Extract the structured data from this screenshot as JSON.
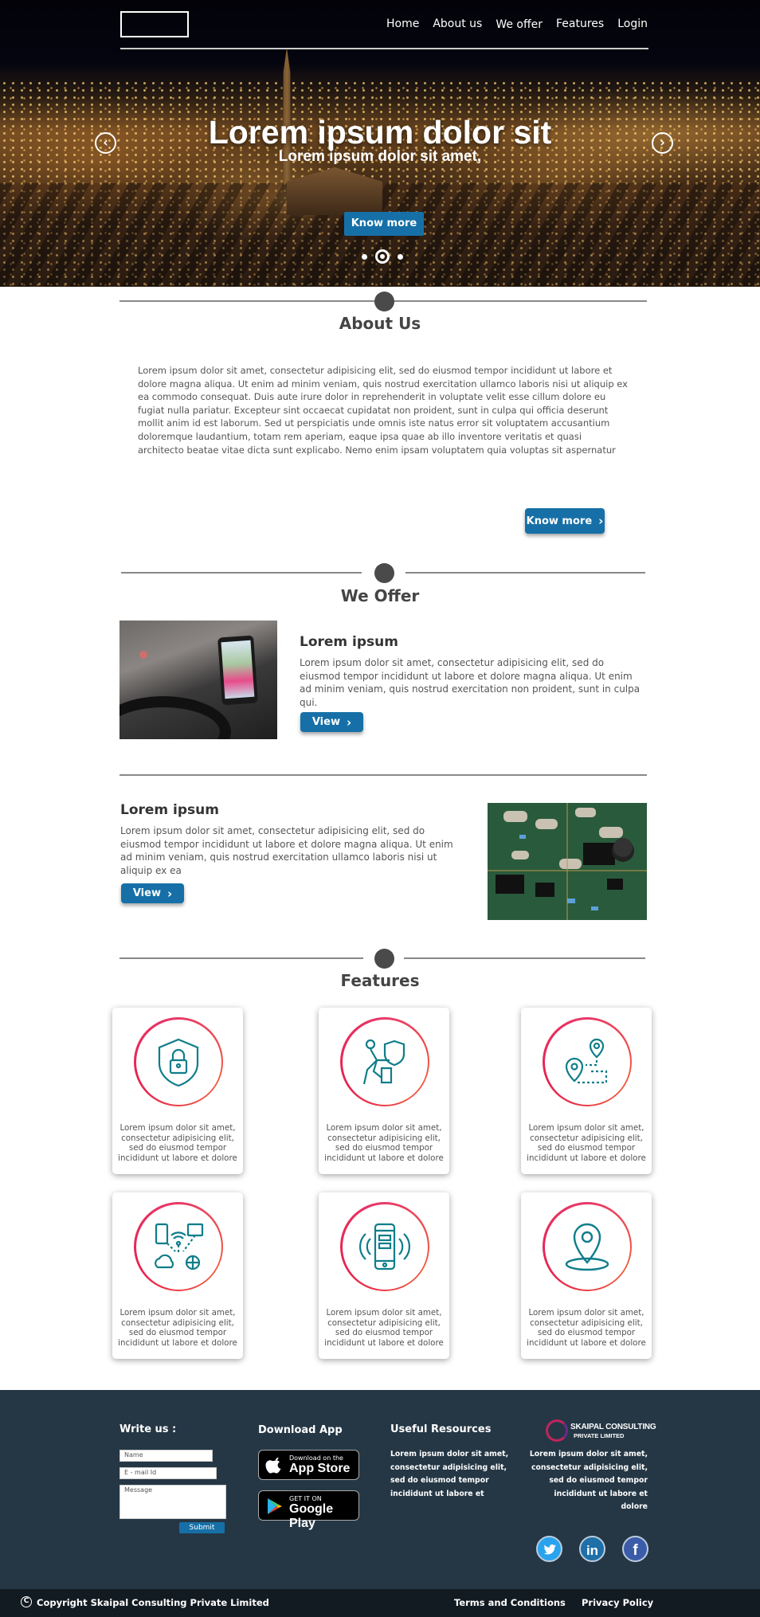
{
  "nav": {
    "items": [
      "Home",
      "About us",
      "We offer",
      "Features",
      "Login"
    ]
  },
  "hero": {
    "title": "Lorem ipsum dolor sit",
    "subtitle": "Lorem ipsum dolor sit amet,",
    "button": "Know more",
    "prev_icon": "chevron-left-icon",
    "next_icon": "chevron-right-icon",
    "active_slide": 2,
    "slide_count": 3
  },
  "about": {
    "title": "About Us",
    "text": "Lorem ipsum dolor sit amet, consectetur adipisicing elit, sed do eiusmod tempor incididunt ut labore et dolore magna aliqua. Ut enim ad minim veniam, quis nostrud exercitation ullamco laboris nisi ut aliquip ex ea commodo consequat. Duis aute irure dolor in reprehenderit in voluptate velit esse cillum dolore eu fugiat nulla pariatur. Excepteur sint occaecat cupidatat non proident, sunt in culpa qui officia deserunt mollit anim id est laborum. Sed ut perspiciatis unde omnis iste natus error sit voluptatem accusantium doloremque laudantium, totam rem aperiam, eaque ipsa quae ab illo inventore veritatis et quasi architecto beatae vitae dicta sunt explicabo. Nemo enim ipsam voluptatem quia voluptas sit aspernatur",
    "button": "Know more"
  },
  "offer": {
    "title": "We Offer",
    "items": [
      {
        "title": "Lorem ipsum",
        "text": "Lorem ipsum dolor sit amet, consectetur adipisicing elit, sed do eiusmod tempor incididunt ut labore et dolore magna aliqua. Ut enim ad minim veniam, quis nostrud exercitation non proident, sunt in culpa qui.",
        "button": "View"
      },
      {
        "title": "Lorem ipsum",
        "text": "Lorem ipsum dolor sit amet, consectetur adipisicing elit, sed do eiusmod tempor incididunt ut labore et dolore magna aliqua. Ut enim ad minim veniam, quis nostrud exercitation ullamco laboris nisi ut aliquip ex ea",
        "button": "View"
      }
    ]
  },
  "features": {
    "title": "Features",
    "cards": [
      {
        "icon": "shield-lock-icon",
        "text": "Lorem ipsum dolor sit amet, consectetur adipisicing elit, sed do eiusmod tempor incididunt ut labore et dolore"
      },
      {
        "icon": "person-shield-icon",
        "text": "Lorem ipsum dolor sit amet, consectetur adipisicing elit, sed do eiusmod tempor incididunt ut labore et dolore"
      },
      {
        "icon": "route-pins-icon",
        "text": "Lorem ipsum dolor sit amet, consectetur adipisicing elit, sed do eiusmod tempor incididunt ut labore et dolore"
      },
      {
        "icon": "network-devices-icon",
        "text": "Lorem ipsum dolor sit amet, consectetur adipisicing elit, sed do eiusmod tempor incididunt ut labore et dolore"
      },
      {
        "icon": "phone-signal-icon",
        "text": "Lorem ipsum dolor sit amet, consectetur adipisicing elit, sed do eiusmod tempor incididunt ut labore et dolore"
      },
      {
        "icon": "map-pin-icon",
        "text": "Lorem ipsum dolor sit amet, consectetur adipisicing elit, sed do eiusmod tempor incididunt ut labore et dolore"
      }
    ]
  },
  "footer": {
    "write_us": "Write us :",
    "name_placeholder": "Name",
    "email_placeholder": "E - mail Id",
    "message_placeholder": "Message",
    "submit": "Submit",
    "download_title": "Download App",
    "appstore_small": "Download on the",
    "appstore_big": "App Store",
    "playstore_small": "GET IT ON",
    "playstore_big": "Google Play",
    "resources_title": "Useful Resources",
    "resources_text": "Lorem ipsum dolor sit amet, consectetur adipisicing elit, sed do eiusmod tempor incididunt ut labore et",
    "brand_line1": "SKAIPAL CONSULTING",
    "brand_line2": "PRIVATE LIMITED",
    "brand_text": "Lorem ipsum dolor sit amet, consectetur adipisicing elit, sed do eiusmod tempor incididunt ut labore et dolore",
    "social": [
      "twitter-icon",
      "linkedin-icon",
      "facebook-icon"
    ],
    "copyright": "Copyright Skaipal Consulting Private Limited",
    "terms": "Terms and Conditions",
    "privacy": "Privacy Policy"
  }
}
